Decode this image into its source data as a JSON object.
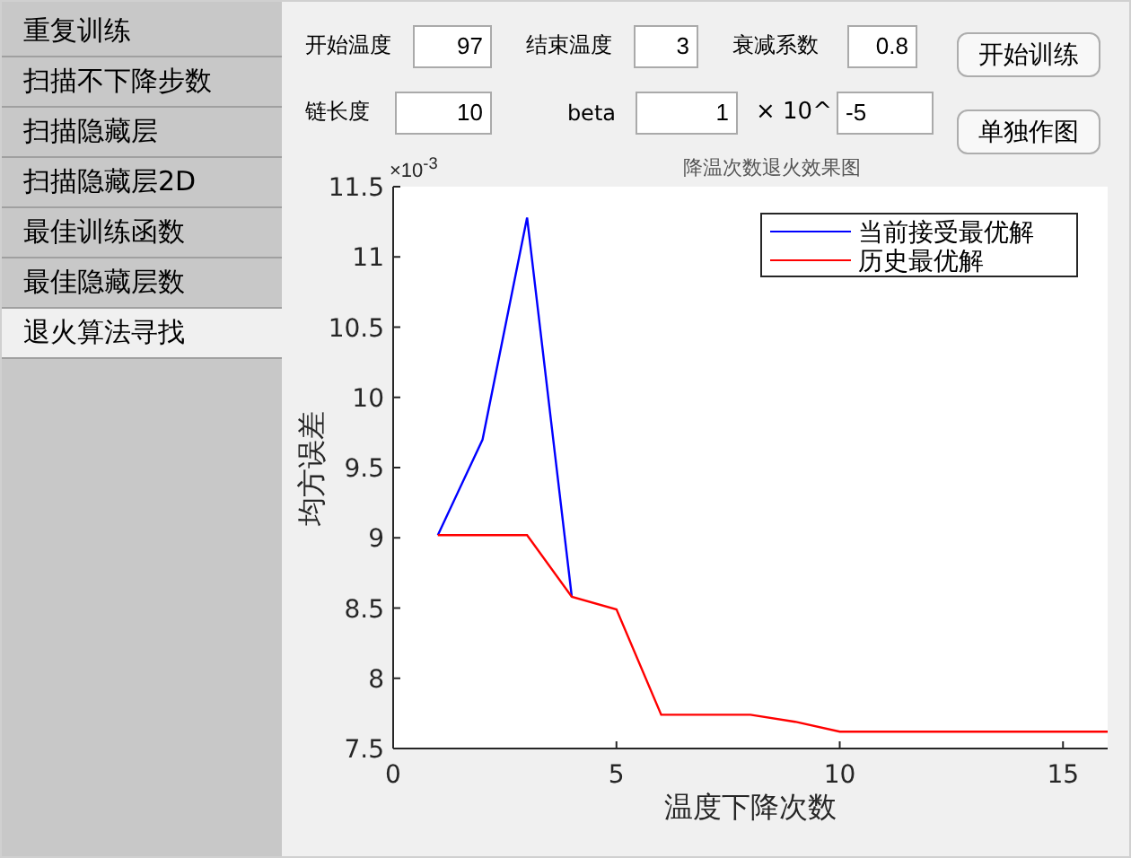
{
  "tabs": [
    {
      "label": "重复训练",
      "selected": false
    },
    {
      "label": "扫描不下降步数",
      "selected": false
    },
    {
      "label": "扫描隐藏层",
      "selected": false
    },
    {
      "label": "扫描隐藏层2D",
      "selected": false
    },
    {
      "label": "最佳训练函数",
      "selected": false
    },
    {
      "label": "最佳隐藏层数",
      "selected": false
    },
    {
      "label": "退火算法寻找",
      "selected": true
    }
  ],
  "params": [
    [
      {
        "label": "开始温度",
        "value": "97"
      },
      {
        "label": "结束温度",
        "value": "3"
      },
      {
        "label": "衰减系数",
        "value": "0.8"
      }
    ],
    [
      {
        "label": "链长度",
        "value": "10"
      },
      {
        "label": "beta",
        "value": "1"
      },
      {
        "label": "× 10^",
        "value": "-5"
      }
    ]
  ],
  "buttons": [
    "开始训练",
    "单独作图"
  ],
  "chart": {
    "exponent": "×10$^{-3}$",
    "chart_data": {
      "type": "line",
      "legend": "upper right",
      "title": "降温次数退火效果图",
      "xlabel": "温度下降次数",
      "ylabel": "均方误差",
      "xlim": [
        0,
        16
      ],
      "ylim": [
        7.5,
        11.5
      ],
      "xticks": [
        0,
        5,
        10,
        15
      ],
      "yticks": [
        7.5,
        8,
        8.5,
        9,
        9.5,
        10,
        10.5,
        11,
        11.5
      ],
      "series": [
        {
          "name": "当前接受最优解",
          "color": "#0000ff",
          "x": [
            1,
            2,
            3,
            4
          ],
          "values": [
            9.02,
            9.7,
            11.28,
            8.58
          ]
        },
        {
          "name": "历史最优解",
          "color": "#ff0000",
          "x": [
            1,
            2,
            3,
            4,
            5,
            6,
            7,
            8,
            9,
            10,
            11,
            12,
            13,
            14,
            15,
            16
          ],
          "values": [
            9.02,
            9.02,
            9.02,
            8.58,
            8.49,
            7.74,
            7.74,
            7.74,
            7.69,
            7.62,
            7.62,
            7.62,
            7.62,
            7.62,
            7.62,
            7.62
          ]
        }
      ]
    }
  }
}
